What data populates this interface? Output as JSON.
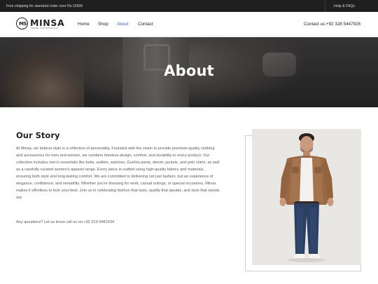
{
  "topbar": {
    "promo": "Free shipping for standard order over Rs.15000",
    "help": "Help & FAQs"
  },
  "header": {
    "logo_mark": "MS",
    "logo_word": "MINSA",
    "logo_tagline": "TREND FOR EVERYDAY",
    "nav": [
      {
        "label": "Home"
      },
      {
        "label": "Shop"
      },
      {
        "label": "About",
        "active": true
      },
      {
        "label": "Contact"
      }
    ],
    "contact": "Contact us:+92 328 5447926"
  },
  "hero": {
    "title": "About"
  },
  "story": {
    "title": "Our Story",
    "body": "At Minsa, we believe style is a reflection of personality. Founded with the vision to provide premium-quality clothing and accessories for men and women, we combine timeless design, comfort, and durability in every product. Our collection includes men's essentials like belts, wallets, watches, Gurkha pants, denim, jackets, and polo shirts, as well as a carefully curated women's apparel range. Every piece is crafted using high-quality fabrics and materials, ensuring both style and long-lasting comfort. We are committed to delivering not just fashion, but an experience of elegance, confidence, and versatility. Whether you're dressing for work, casual outings, or special occasions, Minsa makes it effortless to look your best. Join us in celebrating fashion that lasts, quality that speaks, and style that stands out.",
    "contact_line": "Any questions? Let us know call us on +92 319 6481434"
  },
  "colors": {
    "topbar_bg": "#1f1f1f",
    "accent_active_nav": "#3c63b0",
    "jacket": "#9a6a46",
    "jeans": "#2b3f63"
  }
}
